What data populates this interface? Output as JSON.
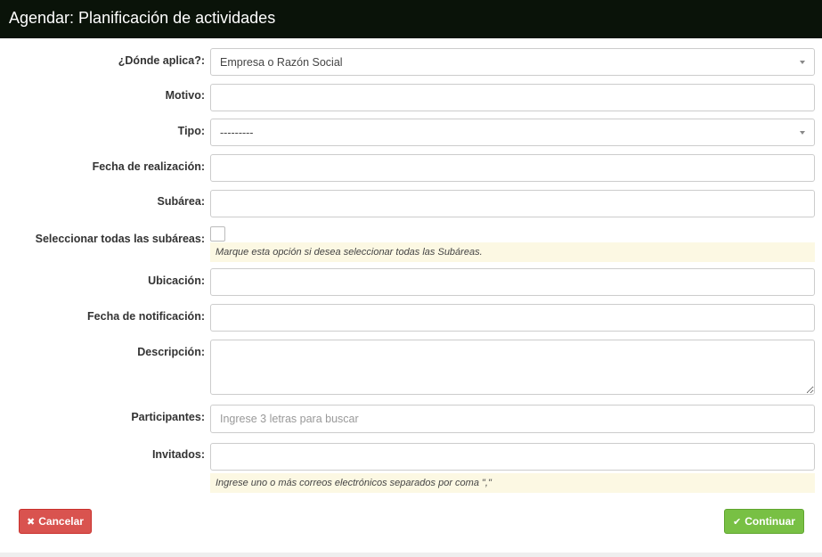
{
  "header": {
    "title": "Agendar: Planificación de actividades"
  },
  "form": {
    "donde_aplica": {
      "label": "¿Dónde aplica?:",
      "value": "Empresa o Razón Social"
    },
    "motivo": {
      "label": "Motivo:",
      "value": ""
    },
    "tipo": {
      "label": "Tipo:",
      "value": "---------"
    },
    "fecha_realizacion": {
      "label": "Fecha de realización:",
      "value": ""
    },
    "subarea": {
      "label": "Subárea:",
      "value": ""
    },
    "todas_subareas": {
      "label": "Seleccionar todas las subáreas:",
      "checked": false,
      "hint": "Marque esta opción si desea seleccionar todas las Subáreas."
    },
    "ubicacion": {
      "label": "Ubicación:",
      "value": ""
    },
    "fecha_notificacion": {
      "label": "Fecha de notificación:",
      "value": ""
    },
    "descripcion": {
      "label": "Descripción:",
      "value": ""
    },
    "participantes": {
      "label": "Participantes:",
      "placeholder": "Ingrese 3 letras para buscar"
    },
    "invitados": {
      "label": "Invitados:",
      "value": "",
      "hint": "Ingrese uno o más correos electrónicos separados por coma \",\""
    }
  },
  "actions": {
    "cancel_label": "Cancelar",
    "cancel_icon": "x-icon",
    "continue_label": "Continuar",
    "continue_icon": "check-icon"
  },
  "colors": {
    "header_bg": "#0a1309",
    "cancel": "#d9534f",
    "continue": "#78c044",
    "hint_bg": "#fcf8e3"
  }
}
